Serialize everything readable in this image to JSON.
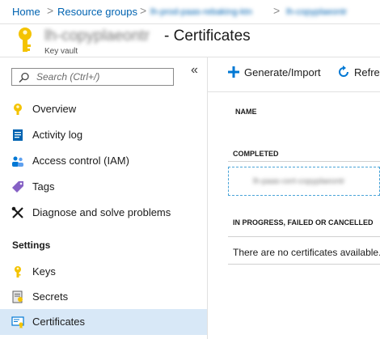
{
  "breadcrumb": {
    "items": [
      "Home",
      "Resource groups",
      "lh-prod-paas-rebaking-ktn",
      "lh-copyplaeontr"
    ],
    "separator": ">"
  },
  "header": {
    "resource_name": "lh-copyplaeontr",
    "dash": "-",
    "title": "Certificates",
    "subtitle": "Key vault",
    "icon": "key-icon"
  },
  "sidebar": {
    "search_placeholder": "Search (Ctrl+/)",
    "collapse_glyph": "«",
    "items": [
      {
        "label": "Overview",
        "icon": "overview-icon"
      },
      {
        "label": "Activity log",
        "icon": "activity-log-icon"
      },
      {
        "label": "Access control (IAM)",
        "icon": "iam-icon"
      },
      {
        "label": "Tags",
        "icon": "tag-icon"
      },
      {
        "label": "Diagnose and solve problems",
        "icon": "wrench-icon"
      }
    ],
    "settings_label": "Settings",
    "settings_items": [
      {
        "label": "Keys",
        "icon": "key-icon"
      },
      {
        "label": "Secrets",
        "icon": "secret-icon"
      },
      {
        "label": "Certificates",
        "icon": "certificate-icon",
        "selected": true
      }
    ]
  },
  "commands": {
    "generate_import": "Generate/Import",
    "refresh": "Refre"
  },
  "content": {
    "name_header": "NAME",
    "completed_label": "COMPLETED",
    "certificate_name": "lh-paas-cert-copyplaeontr",
    "in_progress_label": "IN PROGRESS, FAILED OR CANCELLED",
    "empty_message": "There are no certificates available."
  },
  "colors": {
    "accent": "#0078d4",
    "link": "#0063b1",
    "selected_bg": "#d8e8f7",
    "key_yellow": "#f4c300"
  }
}
